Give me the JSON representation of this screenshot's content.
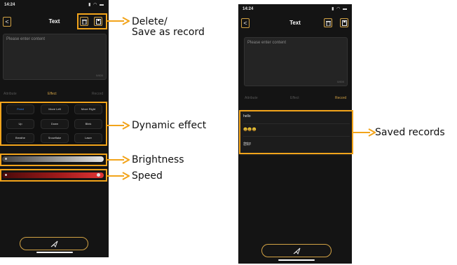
{
  "left_phone": {
    "status_time": "14:24",
    "status_icons": "▮ ◠ ▬",
    "back_glyph": "<",
    "title": "Text",
    "placeholder": "Please enter content",
    "char_count": "0/600",
    "tabs": [
      "Attribute",
      "Effect",
      "Record"
    ],
    "active_tab": "Effect",
    "effects": [
      "Fixed",
      "Move Left",
      "Move Right",
      "Up",
      "Down",
      "Blink",
      "Breathe",
      "Snowflake",
      "Laser"
    ],
    "selected_effect": "Fixed",
    "brightness_value": 1.0,
    "speed_value": 1.0
  },
  "right_phone": {
    "status_time": "14:24",
    "status_icons": "▮ ◠ ▬",
    "back_glyph": "<",
    "title": "Text",
    "placeholder": "Please enter content",
    "char_count": "0/600",
    "tabs": [
      "Attribute",
      "Effect",
      "Record"
    ],
    "active_tab": "Record",
    "records": [
      "hello",
      "😀😀😀",
      "您好!"
    ]
  },
  "annotations": {
    "delete_save": "Delete/\nSave as record",
    "dynamic_effect": "Dynamic effect",
    "brightness": "Brightness",
    "speed": "Speed",
    "saved_records": "Saved records"
  },
  "colors": {
    "accent": "#d2a244",
    "callout": "#f2a41b",
    "selected_effect": "#3a8cff",
    "speed_bar": "#e23535"
  }
}
